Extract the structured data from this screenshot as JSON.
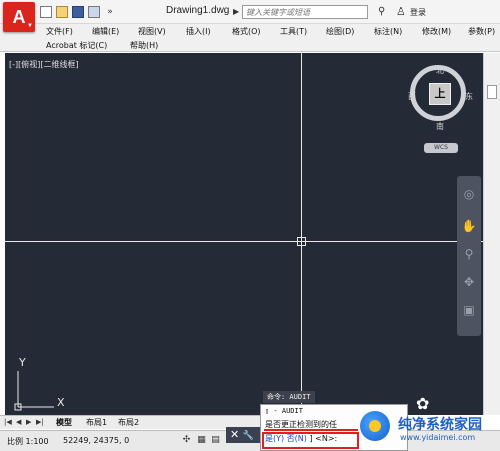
{
  "titlebar": {
    "app_letter": "A",
    "doc_title": "Drawing1.dwg",
    "search_placeholder": "键入关键字或短语",
    "login_label": "登录"
  },
  "menubar": {
    "items": [
      "文件(F)",
      "编辑(E)",
      "视图(V)",
      "插入(I)",
      "格式(O)",
      "工具(T)",
      "绘图(D)",
      "标注(N)",
      "修改(M)",
      "参数(P)",
      "Acrobat 标记(C)",
      "帮助(H)"
    ]
  },
  "canvas": {
    "viewport_label": "[-][俯视][二维线框]",
    "bg_color": "#242a36"
  },
  "viewcube": {
    "top_face": "上",
    "north": "北",
    "south": "南",
    "east": "东",
    "west": "西",
    "wcs": "WCS"
  },
  "ucs": {
    "y": "Y",
    "x": "X"
  },
  "tabs": {
    "model": "模型",
    "layout1": "布局1",
    "layout2": "布局2"
  },
  "statusbar": {
    "scale": "比例 1:100",
    "coords": "52249, 24375, 0"
  },
  "command": {
    "tooltip": "命令: AUDIT",
    "history_cmd": "AUDIT",
    "history_question": "是否更正检测到的任",
    "prompt_yes": "是(Y)",
    "prompt_no": "否(N)",
    "prompt_suffix": "] <N>:"
  },
  "watermark": {
    "title": "纯净系统家园",
    "url": "www.yidaimei.com"
  }
}
